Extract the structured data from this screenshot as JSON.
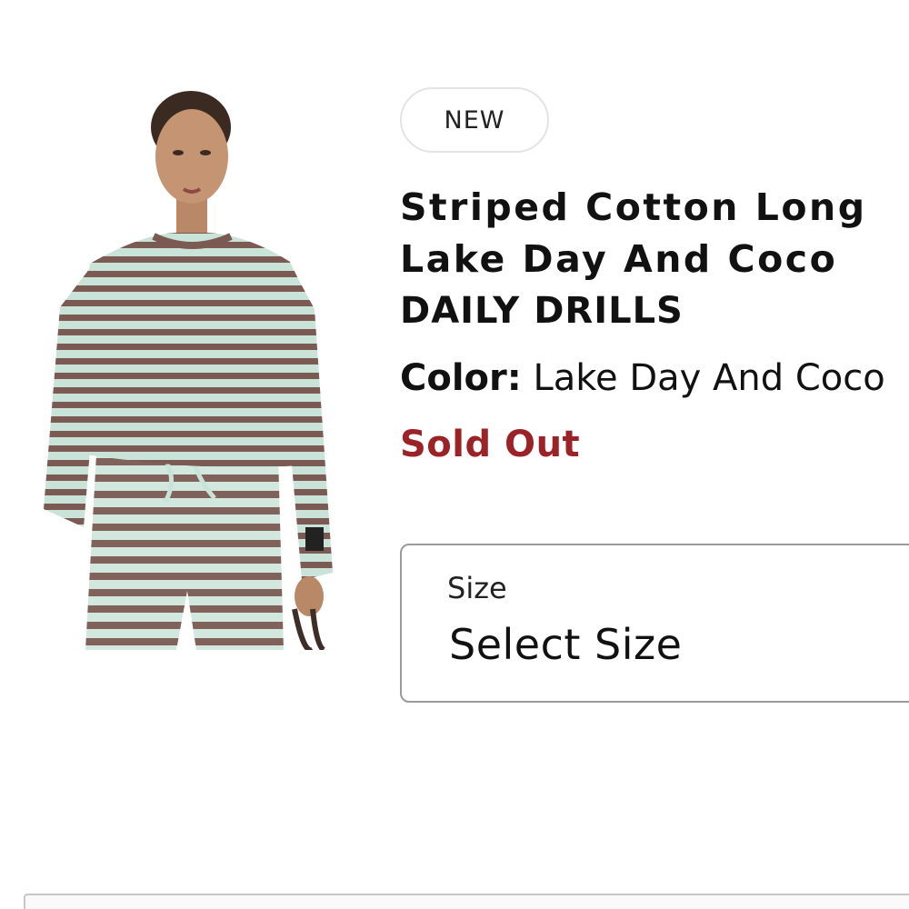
{
  "product": {
    "badge": "NEW",
    "title_line1": "Striped Cotton Long",
    "title_line2": "Lake Day And Coco",
    "brand": "DAILY DRILLS",
    "color_label": "Color:",
    "color_value": "Lake Day And Coco",
    "status": "Sold Out",
    "image_alt": "Model wearing striped cotton long sleeve top and matching pants"
  },
  "size_selector": {
    "label": "Size",
    "value": "Select Size"
  },
  "colors": {
    "sold_out": "#9b2227",
    "stripe_brown": "#7a5a52",
    "stripe_mint": "#c9e3d9"
  }
}
